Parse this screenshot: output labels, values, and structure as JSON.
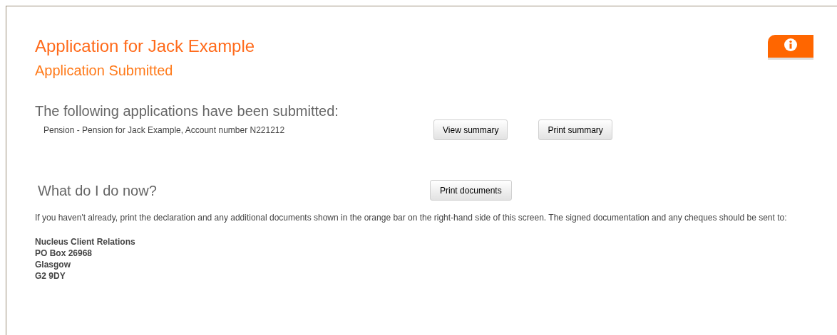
{
  "title": "Application for Jack Example",
  "subtitle": "Application Submitted",
  "submitted": {
    "heading": "The following applications have been submitted:",
    "items": [
      {
        "text": "Pension - Pension for Jack Example, Account number N221212",
        "buttons": [
          "View summary",
          "Print summary"
        ]
      }
    ]
  },
  "next_steps": {
    "heading": "What do I do now?",
    "button": "Print documents",
    "text": "If you haven't already, print the declaration and any additional documents shown in the orange bar on the right-hand side of this screen. The signed documentation and any cheques should be sent to:",
    "address": [
      "Nucleus Client Relations",
      "PO Box 26968",
      "Glasgow",
      "G2 9DY"
    ]
  }
}
